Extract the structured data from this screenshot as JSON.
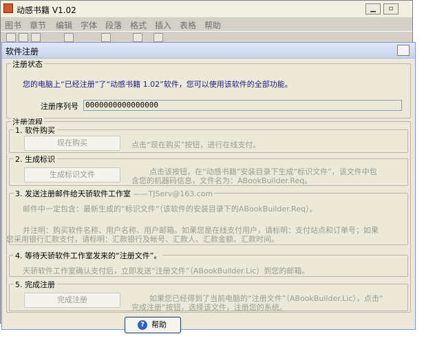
{
  "app": {
    "title": "动感书籍 V1.02",
    "menu": [
      "图书",
      "章节",
      "编辑",
      "字体",
      "段落",
      "格式",
      "插入",
      "表格",
      "帮助"
    ]
  },
  "dialog": {
    "title": "软件注册",
    "status_group": {
      "legend": "注册状态",
      "message": "您的电脑上“已经注册”了“动感书籍 1.02”软件，您可以使用该软件的全部功能。",
      "serial_label": "注册序列号",
      "serial_value": "0000000000000000"
    },
    "flow_group": {
      "legend": "注册流程",
      "step1": {
        "legend": "1. 软件购买",
        "button": "现在购买",
        "desc": "点击“现在购买”按钮，进行在线支付。"
      },
      "step2": {
        "legend": "2. 生成标识",
        "button": "生成标识文件",
        "desc_line1": "点击该按钮，在“动感书籍”安装目录下生成“标识文件”，该文件中包",
        "desc_line2": "含您的机器码信息，文件名为：ABookBuilder.Req。"
      },
      "step3": {
        "legend": "3. 发送注册邮件给天骄软件工作室",
        "email": "TJServ@163.com",
        "line1": "邮件中一定包含：最新生成的“标识文件”（该软件的安装目录下的ABookBuilder.Req）。",
        "line2": "并注明：购买软件名称、用户名称、用户邮箱。如果您是在线支付用户，请标明：支付站点和订单号；如果",
        "line3": "您采用银行汇款支付，请标明：汇款银行及帐号、汇款人、汇款金额、汇款时间。"
      },
      "step4": {
        "legend": "4. 等待天骄软件工作室发来的“注册文件”。",
        "desc": "天骄软件工作室确认支付后，立即发送“注册文件”（ABookBuilder.Lic）到您的邮箱。"
      },
      "step5": {
        "legend": "5. 完成注册",
        "button": "完成注册",
        "desc_line1": "如果您已经得到了当前电脑的“注册文件”（ABookBuilder.Lic），点击“",
        "desc_line2": "完成注册”按钮，选择该文件，注册您的系统。"
      }
    },
    "help_button": "帮助"
  },
  "icons": {
    "help": "question-icon",
    "app": "app-logo-icon"
  },
  "colors": {
    "dialog_bg": "#ece9d8",
    "status_text": "#1a1a8a",
    "disabled_text": "#9c9a92"
  }
}
